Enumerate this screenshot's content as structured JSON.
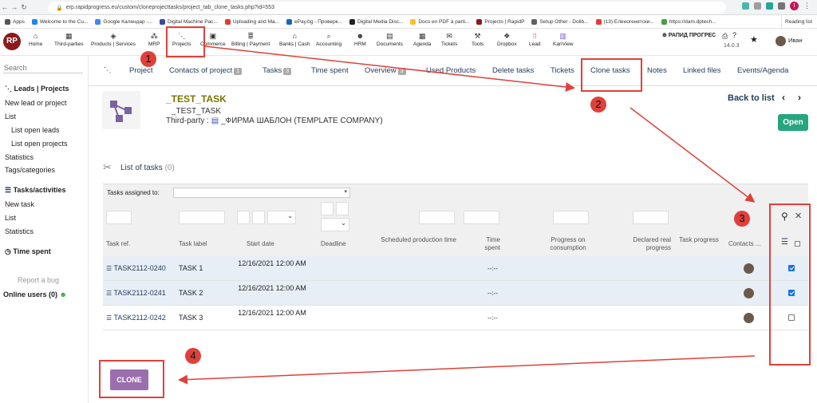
{
  "browser": {
    "url": "erp.rapidprogress.eu/custom/cloneprojecttasks/project_tab_clone_tasks.php?id=553",
    "bookmarks": [
      "Apps",
      "Welcome to the Cu...",
      "Google Календар -...",
      "Digital Machine Pac...",
      "Uploading and Ma...",
      "ePay.bg - Проверк...",
      "Digital Media Disc...",
      "Docs en PDF à parti...",
      "Projects | RapidP",
      "Setup Other - Dolib...",
      "(13) Еленогенетски...",
      "https://dam.dptech..."
    ],
    "reading_list": "Reading list",
    "profile_initial": "I"
  },
  "topmenu": {
    "logo": "RP",
    "items": [
      "Home",
      "Third-parties",
      "Products | Services",
      "MRP",
      "Projects",
      "Commerce",
      "Billing | Payment",
      "Banks | Cash",
      "Accounting",
      "HRM",
      "Documents",
      "Agenda",
      "Tickets",
      "Tools",
      "Dropbox",
      "Lead",
      "KanView"
    ],
    "company": "⊕ РАПИД ПРОГРЕС",
    "version": "14.0.3",
    "user": "Иван"
  },
  "sidebar": {
    "search_placeholder": "Search",
    "leads_title": "Leads | Projects",
    "new_lead": "New lead or project",
    "list": "List",
    "list_open_leads": "List open leads",
    "list_open_projects": "List open projects",
    "statistics": "Statistics",
    "tags": "Tags/categories",
    "tasks_title": "Tasks/activities",
    "new_task": "New task",
    "list2": "List",
    "statistics2": "Statistics",
    "time_spent": "Time spent",
    "report_bug": "Report a bug",
    "online_users": "Online users (0)"
  },
  "tabs": {
    "project": "Project",
    "contacts": "Contacts of project",
    "contacts_count": "1",
    "tasks": "Tasks",
    "tasks_count": "3",
    "time_spent": "Time spent",
    "overview": "Overview",
    "overview_count": "3",
    "used_products": "Used Products",
    "delete_tasks": "Delete tasks",
    "tickets": "Tickets",
    "clone_tasks": "Clone tasks",
    "notes": "Notes",
    "linked_files": "Linked files",
    "events": "Events/Agenda"
  },
  "project": {
    "ref": "_TEST_TASK",
    "title": "_TEST_TASK",
    "third_party_label": "Third-party :",
    "third_party": "_ФИРМА ШАБЛОН (TEMPLATE COMPANY)",
    "back_to_list": "Back to list",
    "status": "Open"
  },
  "task_list": {
    "title": "List of tasks",
    "count": "(0)",
    "assigned_label": "Tasks assigned to:",
    "headers": {
      "ref": "Task ref.",
      "label": "Task label",
      "start": "Start date",
      "deadline": "Deadline",
      "scheduled": "Scheduled production time",
      "time_spent": "Time spent",
      "progress_consumption": "Progress on consumption",
      "declared_progress": "Declared real progress",
      "task_progress": "Task progress",
      "contacts": "Contacts ..."
    },
    "rows": [
      {
        "ref": "TASK2112-0240",
        "label": "TASK 1",
        "start": "12/16/2021 12:00 AM",
        "time_spent": "--:--",
        "checked": true
      },
      {
        "ref": "TASK2112-0241",
        "label": "TASK 2",
        "start": "12/16/2021 12:00 AM",
        "time_spent": "--:--",
        "checked": true
      },
      {
        "ref": "TASK2112-0242",
        "label": "TASK 3",
        "start": "12/16/2021 12:00 AM",
        "time_spent": "--:--",
        "checked": false
      }
    ]
  },
  "clone_button": "CLONE",
  "annotations": [
    "1",
    "2",
    "3",
    "4"
  ],
  "colors": {
    "accent": "#263c5c",
    "annotation": "#e0403a",
    "clone": "#9b6fae",
    "open": "#25a580"
  }
}
